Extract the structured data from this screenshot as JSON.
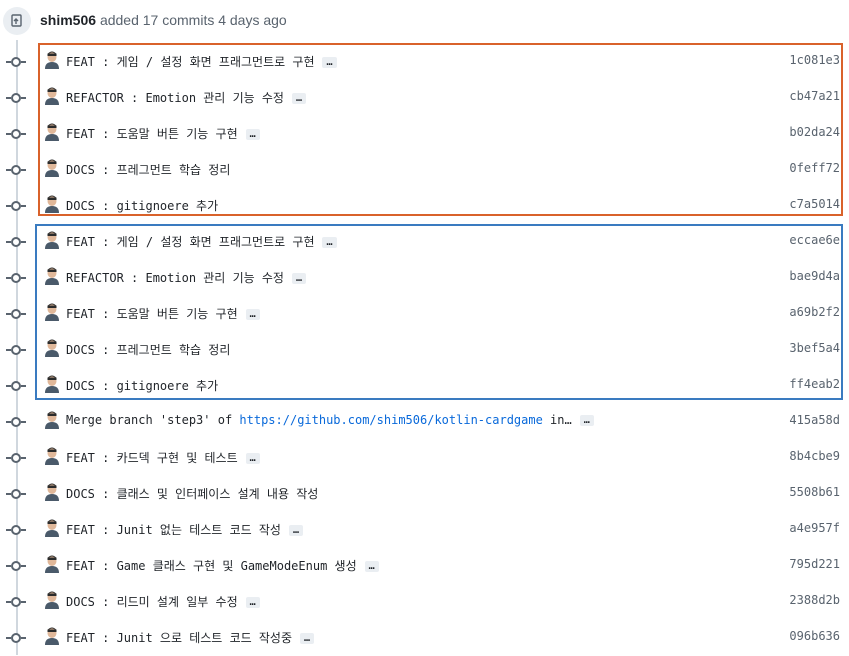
{
  "header": {
    "user": "shim506",
    "action": "added 17 commits 4 days ago",
    "icon": "push-icon"
  },
  "commits": [
    {
      "message": "FEAT : 게임 / 설정 화면 프래그먼트로 구현",
      "sha": "1c081e3",
      "ellipsis": "…"
    },
    {
      "message": "REFACTOR : Emotion 관리 기능 수정",
      "sha": "cb47a21",
      "ellipsis": "…"
    },
    {
      "message": "FEAT : 도움말 버튼 기능 구현",
      "sha": "b02da24",
      "ellipsis": "…"
    },
    {
      "message": "DOCS : 프레그먼트 학습 정리",
      "sha": "0feff72",
      "ellipsis": ""
    },
    {
      "message": "DOCS : gitignoere 추가",
      "sha": "c7a5014",
      "ellipsis": ""
    },
    {
      "message": "FEAT : 게임 / 설정 화면 프래그먼트로 구현",
      "sha": "eccae6e",
      "ellipsis": "…"
    },
    {
      "message": "REFACTOR : Emotion 관리 기능 수정",
      "sha": "bae9d4a",
      "ellipsis": "…"
    },
    {
      "message": "FEAT : 도움말 버튼 기능 구현",
      "sha": "a69b2f2",
      "ellipsis": "…"
    },
    {
      "message": "DOCS : 프레그먼트 학습 정리",
      "sha": "3bef5a4",
      "ellipsis": ""
    },
    {
      "message": "DOCS : gitignoere 추가",
      "sha": "ff4eab2",
      "ellipsis": ""
    },
    {
      "message": "Merge branch 'step3' of ",
      "link": "https://github.com/shim506/kotlin-cardgame",
      "suffix": " in…",
      "sha": "415a58d",
      "ellipsis": "…"
    },
    {
      "message": "FEAT : 카드덱 구현 및 테스트",
      "sha": "8b4cbe9",
      "ellipsis": "…"
    },
    {
      "message": "DOCS : 클래스 및 인터페이스 설계 내용 작성",
      "sha": "5508b61",
      "ellipsis": ""
    },
    {
      "message": "FEAT : Junit 없는 테스트 코드 작성",
      "sha": "a4e957f",
      "ellipsis": "…"
    },
    {
      "message": "FEAT : Game 클래스 구현 및 GameModeEnum 생성",
      "sha": "795d221",
      "ellipsis": "…"
    },
    {
      "message": "DOCS : 리드미 설계 일부 수정",
      "sha": "2388d2b",
      "ellipsis": "…"
    },
    {
      "message": "FEAT : Junit 으로 테스트 코드 작성중",
      "sha": "096b636",
      "ellipsis": "…"
    }
  ],
  "highlight_colors": {
    "orange": "#d9622b",
    "blue": "#3a7bc0"
  }
}
